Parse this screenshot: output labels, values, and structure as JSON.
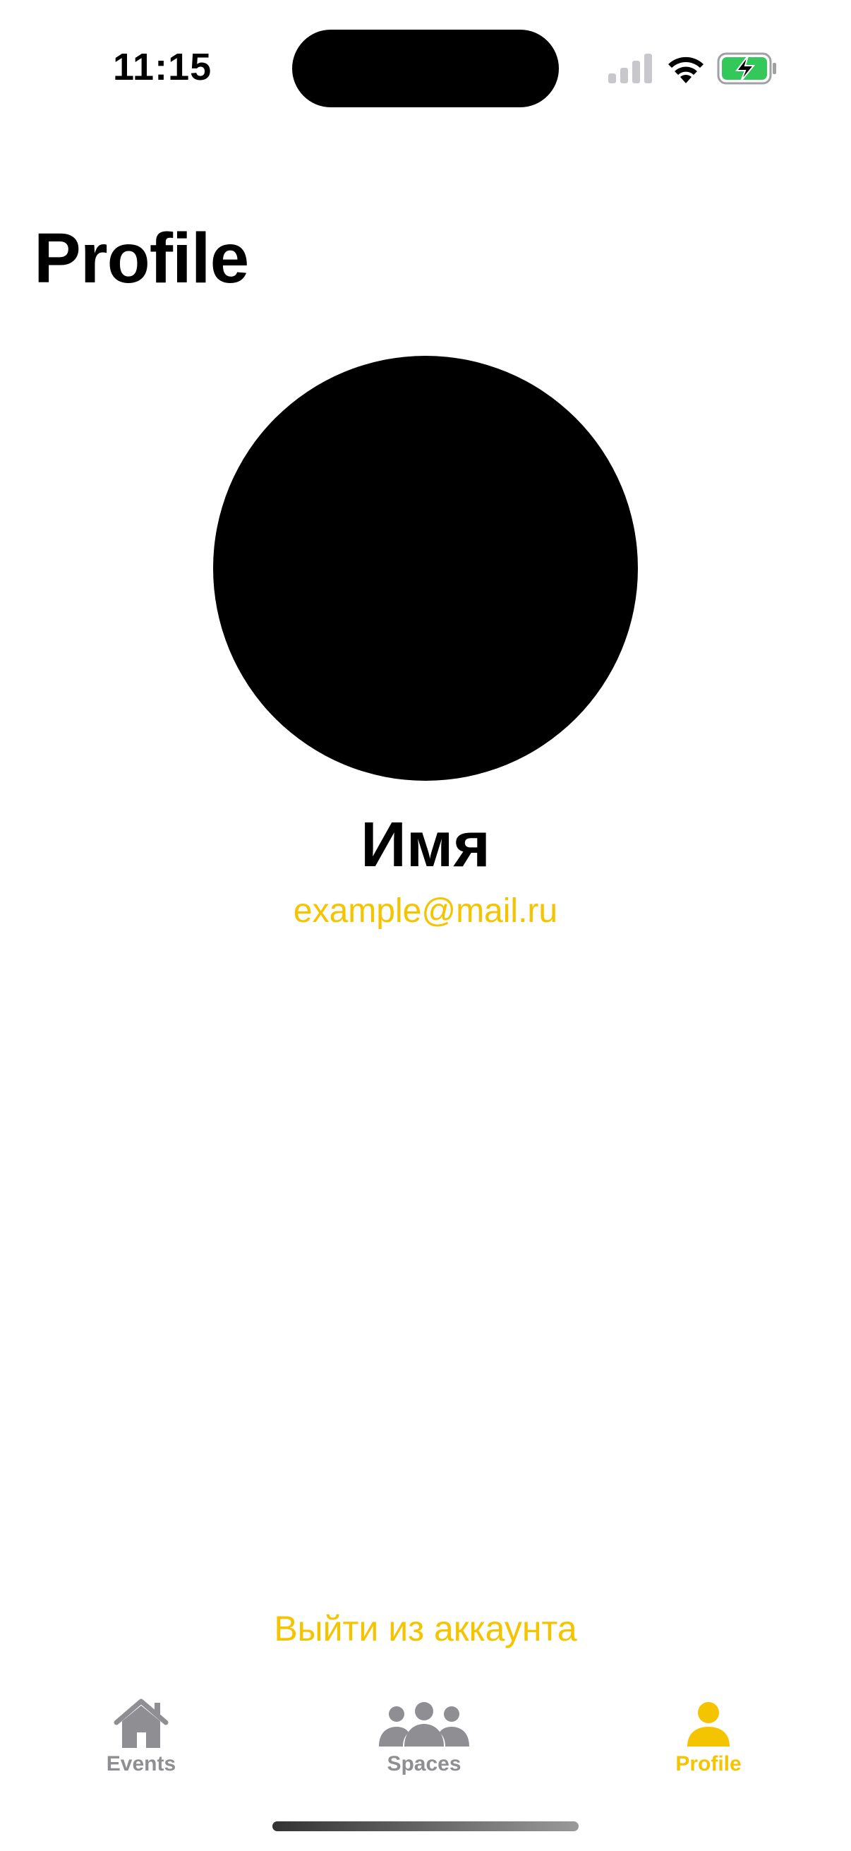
{
  "status_bar": {
    "time": "11:15",
    "icons": [
      "signal-icon",
      "wifi-icon",
      "battery-charging-icon"
    ]
  },
  "page": {
    "title": "Profile"
  },
  "profile": {
    "name": "Имя",
    "email": "example@mail.ru"
  },
  "actions": {
    "logout_label": "Выйти из аккаунта"
  },
  "tab_bar": {
    "tabs": [
      {
        "label": "Events",
        "icon": "house-icon",
        "active": false
      },
      {
        "label": "Spaces",
        "icon": "people-group-icon",
        "active": false
      },
      {
        "label": "Profile",
        "icon": "person-icon",
        "active": true
      }
    ]
  },
  "colors": {
    "accent": "#f5c400",
    "inactive": "#8e8e93",
    "battery": "#34c759"
  }
}
